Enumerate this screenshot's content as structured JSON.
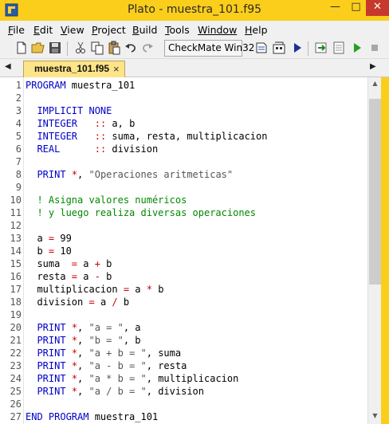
{
  "window": {
    "title": "Plato - muestra_101.f95",
    "minimize_label": "—",
    "maximize_label": "□",
    "close_label": "✕",
    "accent_color": "#fbce1c"
  },
  "menu": [
    {
      "pre": "",
      "key": "F",
      "post": "ile"
    },
    {
      "pre": "",
      "key": "E",
      "post": "dit"
    },
    {
      "pre": "",
      "key": "V",
      "post": "iew"
    },
    {
      "pre": "",
      "key": "P",
      "post": "roject"
    },
    {
      "pre": "",
      "key": "B",
      "post": "uild"
    },
    {
      "pre": "",
      "key": "T",
      "post": "ools"
    },
    {
      "pre": "",
      "key": "W",
      "post": "indow"
    },
    {
      "pre": "",
      "key": "H",
      "post": "elp"
    }
  ],
  "toolbar": {
    "config_combo": "CheckMate Win32",
    "icons": [
      "new-file-icon",
      "open-folder-icon",
      "save-icon",
      "cut-icon",
      "copy-icon",
      "paste-icon",
      "undo-icon",
      "redo-icon",
      "compile-icon",
      "build-icon",
      "run-icon",
      "step-into-icon",
      "step-over-icon",
      "debug-run-icon",
      "stop-icon"
    ]
  },
  "tabs": {
    "active": "muestra_101.f95",
    "close_label": "×",
    "left_arrow": "◀",
    "right_arrow": "▶"
  },
  "editor": {
    "lines": [
      {
        "n": "1",
        "t": [
          [
            "kw",
            "PROGRAM"
          ],
          [
            "id",
            " muestra_101"
          ]
        ]
      },
      {
        "n": "2",
        "t": []
      },
      {
        "n": "3",
        "t": [
          [
            "id",
            "  "
          ],
          [
            "kw",
            "IMPLICIT NONE"
          ]
        ]
      },
      {
        "n": "4",
        "t": [
          [
            "id",
            "  "
          ],
          [
            "kw",
            "INTEGER"
          ],
          [
            "id",
            "   "
          ],
          [
            "op",
            "::"
          ],
          [
            "id",
            " a, b"
          ]
        ]
      },
      {
        "n": "5",
        "t": [
          [
            "id",
            "  "
          ],
          [
            "kw",
            "INTEGER"
          ],
          [
            "id",
            "   "
          ],
          [
            "op",
            "::"
          ],
          [
            "id",
            " suma, resta, multiplicacion"
          ]
        ]
      },
      {
        "n": "6",
        "t": [
          [
            "id",
            "  "
          ],
          [
            "kw",
            "REAL"
          ],
          [
            "id",
            "      "
          ],
          [
            "op",
            "::"
          ],
          [
            "id",
            " division"
          ]
        ]
      },
      {
        "n": "7",
        "t": []
      },
      {
        "n": "8",
        "t": [
          [
            "id",
            "  "
          ],
          [
            "kw",
            "PRINT"
          ],
          [
            "id",
            " "
          ],
          [
            "op",
            "*"
          ],
          [
            "id",
            ", "
          ],
          [
            "str",
            "\"Operaciones aritmeticas\""
          ]
        ]
      },
      {
        "n": "9",
        "t": []
      },
      {
        "n": "10",
        "t": [
          [
            "id",
            "  "
          ],
          [
            "cm",
            "! Asigna valores numéricos"
          ]
        ]
      },
      {
        "n": "11",
        "t": [
          [
            "id",
            "  "
          ],
          [
            "cm",
            "! y luego realiza diversas operaciones"
          ]
        ]
      },
      {
        "n": "12",
        "t": []
      },
      {
        "n": "13",
        "t": [
          [
            "id",
            "  a "
          ],
          [
            "op",
            "="
          ],
          [
            "id",
            " 99"
          ]
        ]
      },
      {
        "n": "14",
        "t": [
          [
            "id",
            "  b "
          ],
          [
            "op",
            "="
          ],
          [
            "id",
            " 10"
          ]
        ]
      },
      {
        "n": "15",
        "t": [
          [
            "id",
            "  suma  "
          ],
          [
            "op",
            "="
          ],
          [
            "id",
            " a "
          ],
          [
            "op",
            "+"
          ],
          [
            "id",
            " b"
          ]
        ]
      },
      {
        "n": "16",
        "t": [
          [
            "id",
            "  resta "
          ],
          [
            "op",
            "="
          ],
          [
            "id",
            " a "
          ],
          [
            "op",
            "-"
          ],
          [
            "id",
            " b"
          ]
        ]
      },
      {
        "n": "17",
        "t": [
          [
            "id",
            "  multiplicacion "
          ],
          [
            "op",
            "="
          ],
          [
            "id",
            " a "
          ],
          [
            "op",
            "*"
          ],
          [
            "id",
            " b"
          ]
        ]
      },
      {
        "n": "18",
        "t": [
          [
            "id",
            "  division "
          ],
          [
            "op",
            "="
          ],
          [
            "id",
            " a "
          ],
          [
            "op",
            "/"
          ],
          [
            "id",
            " b"
          ]
        ]
      },
      {
        "n": "19",
        "t": []
      },
      {
        "n": "20",
        "t": [
          [
            "id",
            "  "
          ],
          [
            "kw",
            "PRINT"
          ],
          [
            "id",
            " "
          ],
          [
            "op",
            "*"
          ],
          [
            "id",
            ", "
          ],
          [
            "str",
            "\"a = \""
          ],
          [
            "id",
            ", a"
          ]
        ]
      },
      {
        "n": "21",
        "t": [
          [
            "id",
            "  "
          ],
          [
            "kw",
            "PRINT"
          ],
          [
            "id",
            " "
          ],
          [
            "op",
            "*"
          ],
          [
            "id",
            ", "
          ],
          [
            "str",
            "\"b = \""
          ],
          [
            "id",
            ", b"
          ]
        ]
      },
      {
        "n": "22",
        "t": [
          [
            "id",
            "  "
          ],
          [
            "kw",
            "PRINT"
          ],
          [
            "id",
            " "
          ],
          [
            "op",
            "*"
          ],
          [
            "id",
            ", "
          ],
          [
            "str",
            "\"a + b = \""
          ],
          [
            "id",
            ", suma"
          ]
        ]
      },
      {
        "n": "23",
        "t": [
          [
            "id",
            "  "
          ],
          [
            "kw",
            "PRINT"
          ],
          [
            "id",
            " "
          ],
          [
            "op",
            "*"
          ],
          [
            "id",
            ", "
          ],
          [
            "str",
            "\"a - b = \""
          ],
          [
            "id",
            ", resta"
          ]
        ]
      },
      {
        "n": "24",
        "t": [
          [
            "id",
            "  "
          ],
          [
            "kw",
            "PRINT"
          ],
          [
            "id",
            " "
          ],
          [
            "op",
            "*"
          ],
          [
            "id",
            ", "
          ],
          [
            "str",
            "\"a * b = \""
          ],
          [
            "id",
            ", multiplicacion"
          ]
        ]
      },
      {
        "n": "25",
        "t": [
          [
            "id",
            "  "
          ],
          [
            "kw",
            "PRINT"
          ],
          [
            "id",
            " "
          ],
          [
            "op",
            "*"
          ],
          [
            "id",
            ", "
          ],
          [
            "str",
            "\"a / b = \""
          ],
          [
            "id",
            ", division"
          ]
        ]
      },
      {
        "n": "26",
        "t": []
      },
      {
        "n": "27",
        "t": [
          [
            "kw",
            "END PROGRAM"
          ],
          [
            "id",
            " muestra_101"
          ]
        ]
      }
    ]
  },
  "scrollbar": {
    "up_arrow": "▲",
    "down_arrow": "▼"
  }
}
